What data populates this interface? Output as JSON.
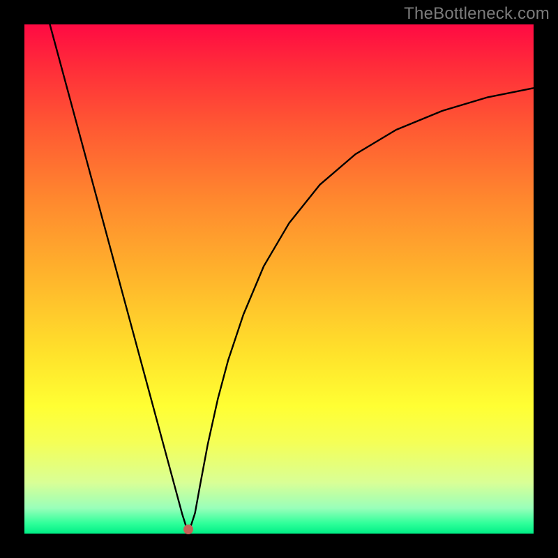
{
  "watermark": "TheBottleneck.com",
  "colors": {
    "frame_bg": "#000000",
    "watermark_text": "#7c7c7c",
    "curve_stroke": "#000000",
    "marker_fill": "#c76258",
    "gradient_top": "#ff0a43",
    "gradient_bottom": "#00ef86"
  },
  "marker": {
    "x_frac": 0.322,
    "y_frac": 0.992
  },
  "chart_data": {
    "type": "line",
    "title": "",
    "xlabel": "",
    "ylabel": "",
    "xlim": [
      0,
      1
    ],
    "ylim": [
      0,
      1
    ],
    "grid": false,
    "legend": false,
    "annotations": [
      "TheBottleneck.com"
    ],
    "note": "Axes unnumbered; values are fractional positions within the plot area (0=left/bottom, 1=right/top). Curve descends from top-left to a minimum near x≈0.32 then rises asymptotically toward the right.",
    "series": [
      {
        "name": "curve",
        "x": [
          0.05,
          0.1,
          0.15,
          0.2,
          0.25,
          0.29,
          0.31,
          0.322,
          0.335,
          0.345,
          0.36,
          0.38,
          0.4,
          0.43,
          0.47,
          0.52,
          0.58,
          0.65,
          0.73,
          0.82,
          0.91,
          1.0
        ],
        "y": [
          1.0,
          0.815,
          0.63,
          0.445,
          0.26,
          0.112,
          0.038,
          0.0,
          0.04,
          0.095,
          0.175,
          0.265,
          0.34,
          0.43,
          0.525,
          0.61,
          0.685,
          0.745,
          0.793,
          0.83,
          0.857,
          0.875
        ]
      }
    ],
    "marker_point": {
      "x": 0.322,
      "y": 0.008
    }
  }
}
